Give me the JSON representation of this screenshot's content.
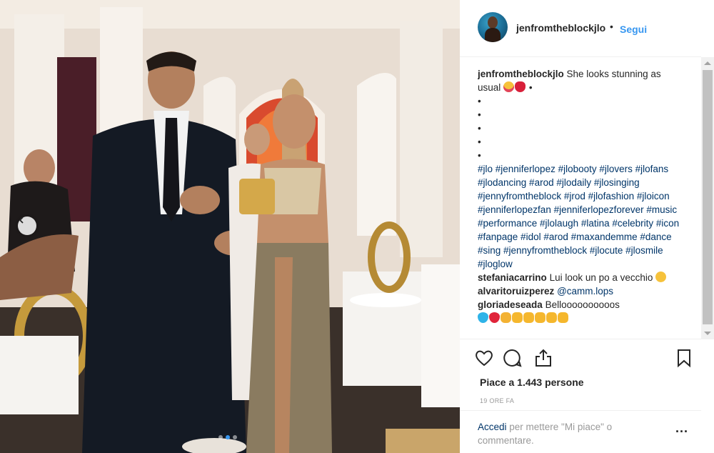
{
  "post": {
    "username": "jenfromtheblockjlo",
    "bullet": "•",
    "follow_label": "Segui"
  },
  "caption": {
    "username": "jenfromtheblockjlo",
    "text": "She looks stunning as usual",
    "trailing": "•",
    "dots": [
      "•",
      "•",
      "•",
      "•",
      "•"
    ],
    "hashtags": "#jlo #jenniferlopez #jlobooty #jlovers #jlofans #jlodancing #arod #jlodaily #jlosinging #jennyfromtheblock #jrod #jlofashion #jloicon #jenniferlopezfan #jenniferlopezforever #music #performance #jlolaugh #latina #celebrity #icon #fanpage #idol #arod #maxandemme #dance #sing #jennyfromtheblock #jlocute #jlosmile #jloglow"
  },
  "comments": [
    {
      "username": "stefaniacarrino",
      "text": "Lui look un po a vecchio"
    },
    {
      "username": "alvaritoruizperez",
      "mention": "@camm.lops"
    },
    {
      "username": "gloriadeseada",
      "text": "Belloooooooooos"
    }
  ],
  "emoji_row": [
    "light-blue-heart",
    "red-heart",
    "folded-hands",
    "clapping-hands",
    "clapping-hands",
    "clapping-hands",
    "clapping-hands",
    "clapping-hands"
  ],
  "likes_label": "Piace a 1.443 persone",
  "time_label": "19 ORE FA",
  "login": {
    "link": "Accedi",
    "text": " per mettere \"Mi piace\" o commentare."
  },
  "more_label": "...",
  "colors": {
    "accent": "#3897f0",
    "link": "#003569",
    "text": "#262626",
    "muted": "#999999"
  }
}
